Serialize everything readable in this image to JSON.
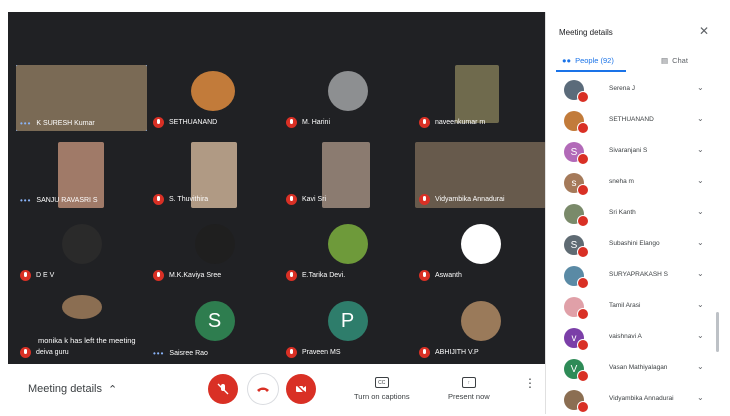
{
  "tiles": [
    {
      "name": "K SURESH Kumar",
      "dots": true,
      "muted": false,
      "highlight": true,
      "video": "#7a6a55",
      "vbox": "0,0,131,66"
    },
    {
      "name": "SETHUANAND",
      "muted": true,
      "video": "#c27b3a",
      "round": true,
      "vbox": "42,6,44,40"
    },
    {
      "name": "M. Harini",
      "muted": true,
      "video": "#8d8f91",
      "round": true,
      "vbox": "46,6,40,40"
    },
    {
      "name": "naveenkumar m",
      "muted": true,
      "video": "#6f6a4d",
      "vbox": "40,0,44,58"
    },
    {
      "name": "SANJU RAVASRI S",
      "dots": true,
      "muted": false,
      "video": "#a07a68",
      "vbox": "42,0,46,66"
    },
    {
      "name": "S. Thuvithira",
      "muted": true,
      "video": "#b09a84",
      "vbox": "42,0,46,66"
    },
    {
      "name": "Kavi Sri",
      "muted": true,
      "video": "#8b7b70",
      "vbox": "40,0,48,66"
    },
    {
      "name": "Vidyambika Annadurai",
      "muted": true,
      "video": "#675a4c",
      "vbox": "0,0,131,66"
    },
    {
      "name": "D E V",
      "muted": true,
      "video": "#2a2a2a",
      "round": true,
      "vbox": "46,6,40,40"
    },
    {
      "name": "M.K.Kaviya Sree",
      "muted": true,
      "video": "#1f1f1f",
      "round": true,
      "vbox": "46,6,40,40"
    },
    {
      "name": "E.Tarika Devi.",
      "muted": true,
      "video": "#6e9a3a",
      "round": true,
      "vbox": "46,6,40,40"
    },
    {
      "name": "Aswanth",
      "muted": true,
      "video": "#ffffff",
      "round": true,
      "vbox": "46,6,40,40"
    },
    {
      "name": "deiva guru",
      "muted": true,
      "video": "#8b6e52",
      "round": true,
      "vbox": "46,0,40,24"
    },
    {
      "name": "Saisree Rao",
      "dots": true,
      "muted": false,
      "avatar": "S",
      "avatarColor": "#2e7d4f"
    },
    {
      "name": "Praveen MS",
      "muted": true,
      "avatar": "P",
      "avatarColor": "#2e7d6b"
    },
    {
      "name": "ABHIJITH V.P",
      "muted": true,
      "video": "#9a7a5a",
      "round": true,
      "vbox": "46,6,40,40"
    }
  ],
  "toast": "monika k has left the meeting",
  "bar": {
    "meeting_details": "Meeting details",
    "captions_label": "Turn on captions",
    "captions_icon": "CC",
    "present_label": "Present now"
  },
  "panel": {
    "title": "Meeting details",
    "people_tab": "People (92)",
    "chat_tab": "Chat",
    "people": [
      {
        "name": "Serena J",
        "avatar": "",
        "color": "#5b6b7a"
      },
      {
        "name": "SETHUANAND",
        "avatar": "",
        "color": "#c27b3a"
      },
      {
        "name": "Sivaranjani S",
        "avatar": "S",
        "color": "#b26ab8"
      },
      {
        "name": "sneha m",
        "avatar": "s",
        "color": "#a57a5a"
      },
      {
        "name": "Sri Kanth",
        "avatar": "",
        "color": "#7a8a6a"
      },
      {
        "name": "Subashini Elango",
        "avatar": "S",
        "color": "#5f6b73"
      },
      {
        "name": "SURYAPRAKASH S",
        "avatar": "",
        "color": "#5a8aa5"
      },
      {
        "name": "Tamil Arasi",
        "avatar": "",
        "color": "#e0a0a8"
      },
      {
        "name": "vaishnavi A",
        "avatar": "v",
        "color": "#7b3fa8"
      },
      {
        "name": "Vasan Mathiyalagan",
        "avatar": "V",
        "color": "#2e8b57"
      },
      {
        "name": "Vidyambika Annadurai",
        "avatar": "",
        "color": "#8b6e52"
      }
    ]
  }
}
